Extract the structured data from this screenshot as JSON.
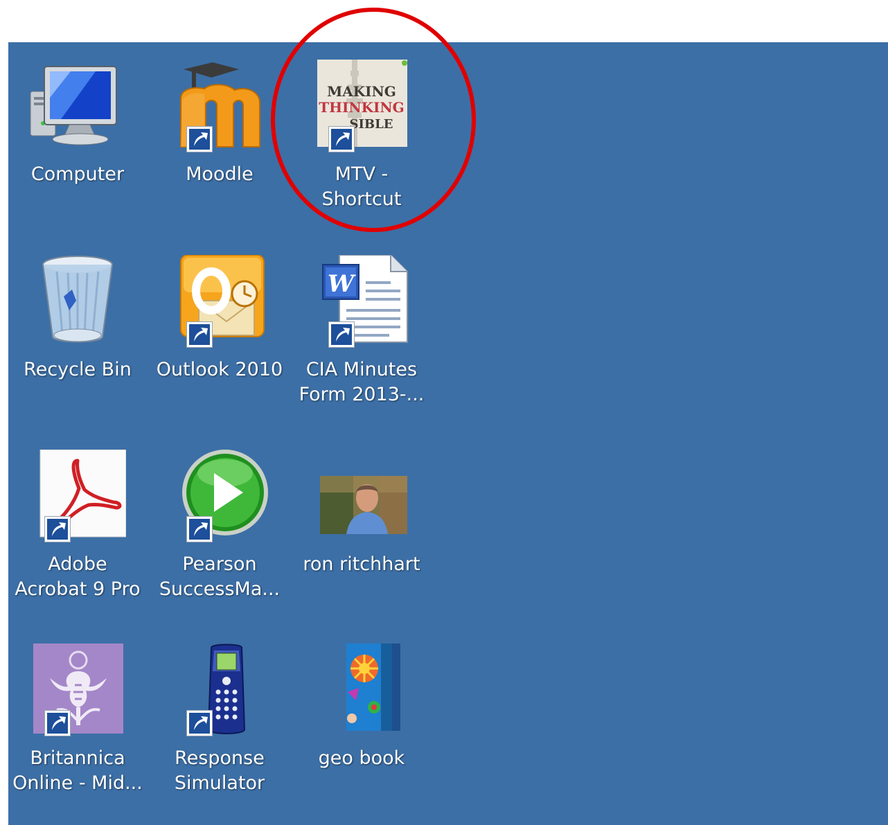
{
  "desktop": {
    "background_color": "#3c6fa6",
    "annotation_color": "#e00000",
    "icons": [
      {
        "label": "Computer",
        "icon": "computer-icon",
        "shortcut": false
      },
      {
        "label": "Moodle",
        "icon": "moodle-icon",
        "shortcut": true
      },
      {
        "label": "MTV - Shortcut",
        "icon": "making-thinking-visible-book-icon",
        "shortcut": true,
        "icon_text": [
          "MAKING",
          "THINKING",
          "SIBLE"
        ]
      },
      {
        "label": "Recycle Bin",
        "icon": "recycle-bin-icon",
        "shortcut": false
      },
      {
        "label": "Outlook 2010",
        "icon": "outlook-icon",
        "shortcut": true
      },
      {
        "label": "CIA Minutes\nForm 2013-...",
        "icon": "word-document-icon",
        "shortcut": true
      },
      {
        "label": "Adobe\nAcrobat 9 Pro",
        "icon": "adobe-acrobat-icon",
        "shortcut": true
      },
      {
        "label": "Pearson\nSuccessMa...",
        "icon": "pearson-play-icon",
        "shortcut": true
      },
      {
        "label": "ron ritchhart",
        "icon": "photo-thumbnail-icon",
        "shortcut": false
      },
      {
        "label": "Britannica\nOnline - Mid...",
        "icon": "britannica-thistle-icon",
        "shortcut": true
      },
      {
        "label": "Response\nSimulator",
        "icon": "response-clicker-icon",
        "shortcut": true
      },
      {
        "label": "geo book",
        "icon": "geo-book-cover-icon",
        "shortcut": false
      }
    ]
  }
}
